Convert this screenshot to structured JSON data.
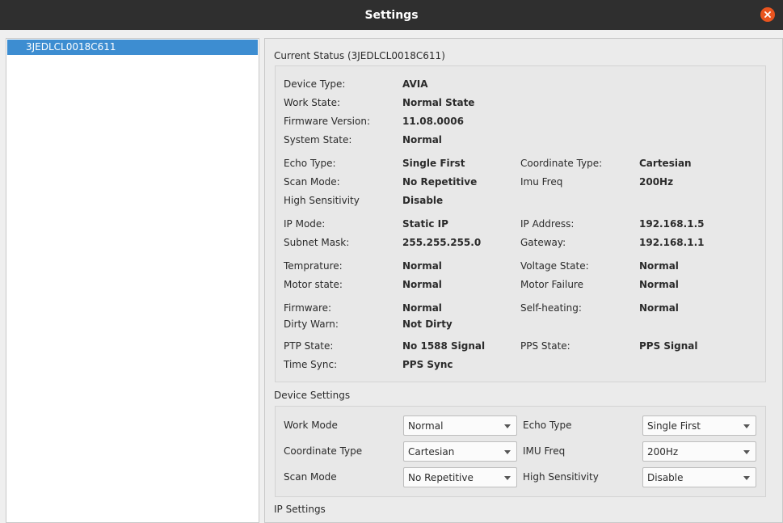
{
  "window": {
    "title": "Settings"
  },
  "device_list": {
    "items": [
      "3JEDLCL0018C611"
    ]
  },
  "current_status": {
    "title": "Current Status (3JEDLCL0018C611)",
    "rows": [
      {
        "l1": "Device Type:",
        "v1": "AVIA",
        "l2": "",
        "v2": ""
      },
      {
        "l1": "Work State:",
        "v1": "Normal State",
        "l2": "",
        "v2": ""
      },
      {
        "l1": "Firmware Version:",
        "v1": "11.08.0006",
        "l2": "",
        "v2": ""
      },
      {
        "l1": "System State:",
        "v1": "Normal",
        "l2": "",
        "v2": ""
      },
      {
        "l1": "Echo Type:",
        "v1": "Single First",
        "l2": "Coordinate Type:",
        "v2": "Cartesian"
      },
      {
        "l1": "Scan Mode:",
        "v1": "No Repetitive",
        "l2": "Imu Freq",
        "v2": "200Hz"
      },
      {
        "l1": "High Sensitivity",
        "v1": "Disable",
        "l2": "",
        "v2": ""
      },
      {
        "l1": "IP Mode:",
        "v1": "Static IP",
        "l2": "IP Address:",
        "v2": "192.168.1.5"
      },
      {
        "l1": "Subnet Mask:",
        "v1": "255.255.255.0",
        "l2": "Gateway:",
        "v2": "192.168.1.1"
      },
      {
        "l1": "Temprature:",
        "v1": "Normal",
        "l2": "Voltage State:",
        "v2": "Normal"
      },
      {
        "l1": "Motor state:",
        "v1": "Normal",
        "l2": "Motor Failure",
        "v2": "Normal"
      },
      {
        "l1": "Firmware:",
        "v1": "Normal",
        "l2": "Self-heating:",
        "v2": "Normal"
      },
      {
        "l1": "Dirty Warn:",
        "v1": "Not Dirty",
        "l2": "",
        "v2": ""
      },
      {
        "l1": "PTP State:",
        "v1": "No 1588 Signal",
        "l2": "PPS State:",
        "v2": "PPS Signal"
      },
      {
        "l1": "Time Sync:",
        "v1": "PPS Sync",
        "l2": "",
        "v2": ""
      }
    ]
  },
  "device_settings": {
    "title": "Device Settings",
    "fields": [
      {
        "label": "Work Mode",
        "value": "Normal"
      },
      {
        "label": "Echo Type",
        "value": "Single First"
      },
      {
        "label": "Coordinate Type",
        "value": "Cartesian"
      },
      {
        "label": "IMU Freq",
        "value": "200Hz"
      },
      {
        "label": "Scan Mode",
        "value": "No Repetitive"
      },
      {
        "label": "High Sensitivity",
        "value": "Disable"
      }
    ]
  },
  "ip_settings": {
    "title": "IP Settings"
  },
  "colors": {
    "titlebar": "#2f2f2f",
    "close": "#e9541f",
    "selection": "#3d8dd1"
  }
}
